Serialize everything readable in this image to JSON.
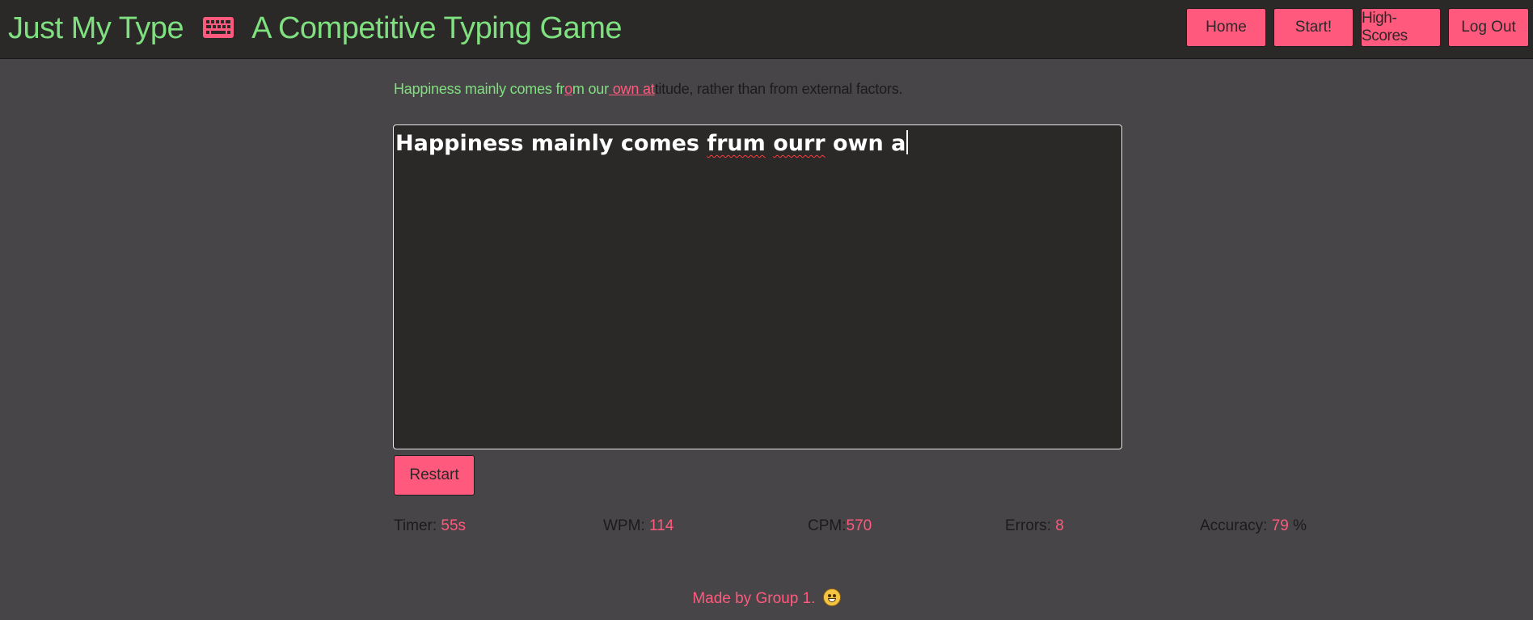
{
  "header": {
    "brand_name": "Just My Type",
    "icon": "keyboard-icon",
    "tagline": "A Competitive Typing Game",
    "nav": {
      "home": "Home",
      "start": "Start!",
      "high_scores": "High-Scores",
      "log_out": "Log Out"
    }
  },
  "prompt": {
    "typed_correct_1": "Happiness mainly comes fr",
    "typed_error_1": "o",
    "typed_correct_2": "m our",
    "current_segment": " own at",
    "remaining": "titude, rather than from external factors."
  },
  "typing_area": {
    "text_part1": "Happiness mainly comes ",
    "misspelled_1": "frum",
    "space_1": " ",
    "misspelled_2": "ourr",
    "text_part2": " own a"
  },
  "restart_label": "Restart",
  "stats": {
    "timer_label": "Timer: ",
    "timer_value": "55s",
    "wpm_label": "WPM: ",
    "wpm_value": "114",
    "cpm_label": "CPM:",
    "cpm_value": "570",
    "errors_label": "Errors: ",
    "errors_value": "8",
    "accuracy_label": "Accuracy: ",
    "accuracy_value": "79",
    "accuracy_unit": " %"
  },
  "footer": {
    "text": "Made by Group 1.",
    "emoji": "grinning-face-icon"
  },
  "colors": {
    "accent_pink": "#ff5a7d",
    "brand_green": "#7fe07f",
    "header_bg": "#2b2828",
    "page_bg": "#474547"
  }
}
